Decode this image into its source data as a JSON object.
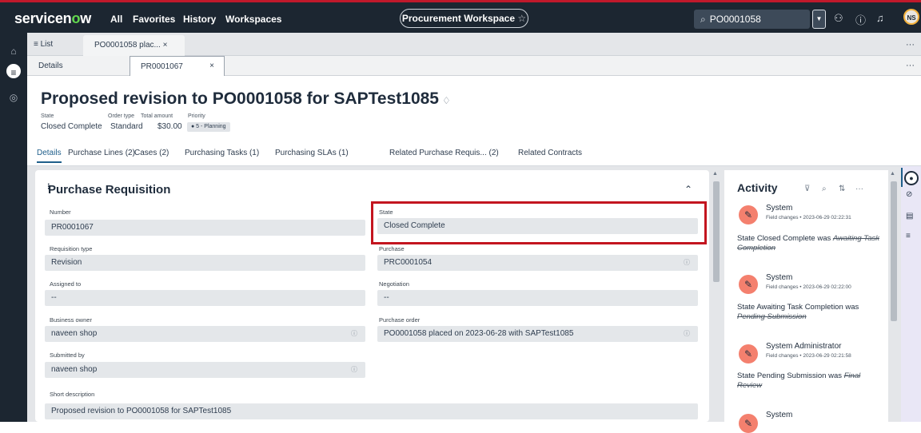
{
  "topbar": {
    "logo_a": "servicen",
    "logo_o": "o",
    "logo_b": "w",
    "nav": [
      "All",
      "Favorites",
      "History",
      "Workspaces"
    ],
    "workspace": "Procurement Workspace",
    "search_value": "PO0001058",
    "avatar_initials": "NS"
  },
  "tabs": {
    "list_label": "≡ List",
    "record_tab": "PO0001058 plac...",
    "details_tab": "Details",
    "pr_tab": "PR0001067"
  },
  "header": {
    "title": "Proposed revision to PO0001058 for SAPTest1085",
    "meta_labels": [
      "State",
      "Order type",
      "Total amount",
      "Priority"
    ],
    "state": "Closed Complete",
    "order_type": "Standard",
    "total_amount": "$30.00",
    "priority": "● 5 - Planning",
    "related_tabs": [
      "Details",
      "Purchase Lines (2)",
      "Cases (2)",
      "Purchasing Tasks (1)",
      "Purchasing SLAs (1)",
      "Related Purchase Requis... (2)",
      "Related Contracts"
    ]
  },
  "form": {
    "section_title": "Purchase Requisition",
    "fields": {
      "number": {
        "label": "Number",
        "value": "PR0001067"
      },
      "state": {
        "label": "State",
        "value": "Closed Complete"
      },
      "requisition_type": {
        "label": "Requisition type",
        "value": "Revision"
      },
      "purchase": {
        "label": "Purchase",
        "value": "PRC0001054"
      },
      "assigned_to": {
        "label": "Assigned to",
        "value": "--"
      },
      "negotiation": {
        "label": "Negotiation",
        "value": "--"
      },
      "business_owner": {
        "label": "Business owner",
        "value": "naveen shop"
      },
      "purchase_order": {
        "label": "Purchase order",
        "value": "PO0001058 placed on 2023-06-28 with SAPTest1085"
      },
      "submitted_by": {
        "label": "Submitted by",
        "value": "naveen shop"
      },
      "short_description": {
        "label": "Short description",
        "value": "Proposed revision to PO0001058 for SAPTest1085"
      }
    }
  },
  "activity": {
    "title": "Activity",
    "entries": [
      {
        "name": "System",
        "sub": "Field changes • 2023-06-29 02:22:31",
        "field": "State",
        "new": "Closed Complete",
        "was": "was",
        "old": "Awaiting Task Completion"
      },
      {
        "name": "System",
        "sub": "Field changes • 2023-06-29 02:22:00",
        "field": "State",
        "new": "Awaiting Task Completion",
        "was": "was",
        "old": "Pending Submission"
      },
      {
        "name": "System Administrator",
        "sub": "Field changes • 2023-06-29 02:21:58",
        "field": "State",
        "new": "Pending Submission",
        "was": "was",
        "old": "Final Review"
      },
      {
        "name": "System"
      }
    ]
  }
}
